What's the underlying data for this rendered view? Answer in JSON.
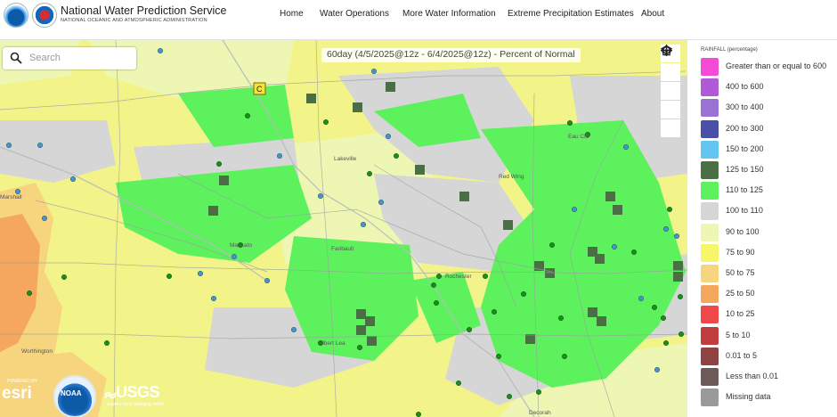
{
  "header": {
    "title": "National Water Prediction Service",
    "subtitle": "NATIONAL OCEANIC AND ATMOSPHERIC ADMINISTRATION",
    "nav": [
      "Home",
      "Water Operations",
      "More Water Information",
      "Extreme Precipitation Estimates",
      "About"
    ]
  },
  "map": {
    "search_placeholder": "Search",
    "title": "60day (4/5/2025@12z - 6/4/2025@12z) - Percent of Normal",
    "tools": [
      "locate-icon",
      "zoom-in-icon",
      "zoom-out-icon",
      "home-icon",
      "layers-icon"
    ],
    "place_labels": [
      "Eau Cla",
      "Lakeville",
      "Faribault",
      "Mankato",
      "Rochester",
      "Albert Lea",
      "Worthington",
      "Decorah",
      "Marshall",
      "Red Wing"
    ],
    "attribution": {
      "esri": "esri",
      "esri_powered": "POWERED BY",
      "noaa": "NOAA",
      "usgs": "USGS",
      "usgs_tagline": "science for a changing world"
    }
  },
  "legend": {
    "title": "RAINFALL (percentage)",
    "items": [
      {
        "label": "Greater than or equal to 600",
        "color": "#f44bd8"
      },
      {
        "label": "400 to 600",
        "color": "#b05ad6"
      },
      {
        "label": "300 to 400",
        "color": "#9a72d6"
      },
      {
        "label": "200 to 300",
        "color": "#4a4fa8"
      },
      {
        "label": "150 to 200",
        "color": "#62c6f1"
      },
      {
        "label": "125 to 150",
        "color": "#4a6f45"
      },
      {
        "label": "110 to 125",
        "color": "#5df15d"
      },
      {
        "label": "100 to 110",
        "color": "#d6d6d6"
      },
      {
        "label": "90 to 100",
        "color": "#eef6b3"
      },
      {
        "label": "75 to 90",
        "color": "#f7f66b"
      },
      {
        "label": "50 to 75",
        "color": "#f7d57e"
      },
      {
        "label": "25 to 50",
        "color": "#f5a75d"
      },
      {
        "label": "10 to 25",
        "color": "#f04848"
      },
      {
        "label": "5 to 10",
        "color": "#c23d3d"
      },
      {
        "label": "0.01 to 5",
        "color": "#8f4343"
      },
      {
        "label": "Less than 0.01",
        "color": "#6f5a5a"
      },
      {
        "label": "Missing data",
        "color": "#9a9a9a"
      }
    ]
  }
}
